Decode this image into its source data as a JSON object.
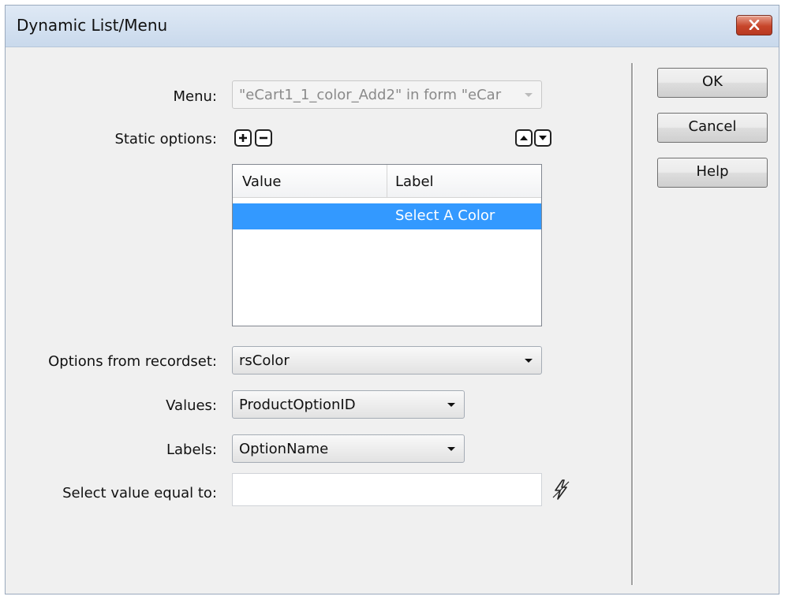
{
  "window": {
    "title": "Dynamic List/Menu"
  },
  "icons": {
    "close": "close-icon",
    "add": "plus-icon",
    "remove": "minus-icon",
    "up": "arrow-up-icon",
    "down": "arrow-down-icon",
    "dropdown": "chevron-down-icon",
    "dynamic_data": "lightning-icon"
  },
  "form": {
    "menu": {
      "label": "Menu:",
      "value": "\"eCart1_1_color_Add2\" in form \"eCar"
    },
    "static_options": {
      "label": "Static options:",
      "columns": [
        "Value",
        "Label"
      ],
      "rows": [
        {
          "value": "",
          "label": "Select A Color",
          "selected": true
        }
      ]
    },
    "recordset": {
      "label": "Options from recordset:",
      "value": "rsColor"
    },
    "values": {
      "label": "Values:",
      "value": "ProductOptionID"
    },
    "labels": {
      "label": "Labels:",
      "value": "OptionName"
    },
    "select_value": {
      "label": "Select value equal to:",
      "value": ""
    }
  },
  "buttons": {
    "ok": "OK",
    "cancel": "Cancel",
    "help": "Help"
  },
  "colors": {
    "selection": "#3399ff",
    "title_bar": "#c9d9ec",
    "close_button": "#c7452a"
  }
}
